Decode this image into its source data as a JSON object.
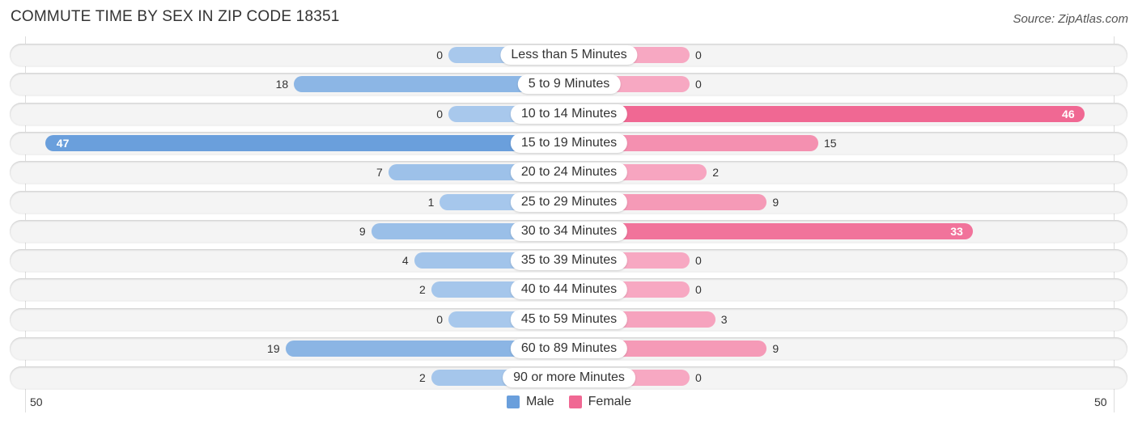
{
  "title": "COMMUTE TIME BY SEX IN ZIP CODE 18351",
  "source": "Source: ZipAtlas.com",
  "colors": {
    "male": "#6a9fdc",
    "female": "#f06893",
    "male_light": "#a8c8ec",
    "female_light": "#f7a8c2"
  },
  "chart_data": {
    "type": "bar",
    "orientation": "horizontal-diverging",
    "title": "COMMUTE TIME BY SEX IN ZIP CODE 18351",
    "categories": [
      "Less than 5 Minutes",
      "5 to 9 Minutes",
      "10 to 14 Minutes",
      "15 to 19 Minutes",
      "20 to 24 Minutes",
      "25 to 29 Minutes",
      "30 to 34 Minutes",
      "35 to 39 Minutes",
      "40 to 44 Minutes",
      "45 to 59 Minutes",
      "60 to 89 Minutes",
      "90 or more Minutes"
    ],
    "series": [
      {
        "name": "Male",
        "values": [
          0,
          18,
          0,
          47,
          7,
          1,
          9,
          4,
          2,
          0,
          19,
          2
        ]
      },
      {
        "name": "Female",
        "values": [
          0,
          0,
          46,
          15,
          2,
          9,
          33,
          0,
          0,
          3,
          9,
          0
        ]
      }
    ],
    "axis": {
      "left_tick": "50",
      "right_tick": "50",
      "max": 50
    },
    "legend": {
      "placement": "bottom-center",
      "items": [
        "Male",
        "Female"
      ]
    }
  }
}
